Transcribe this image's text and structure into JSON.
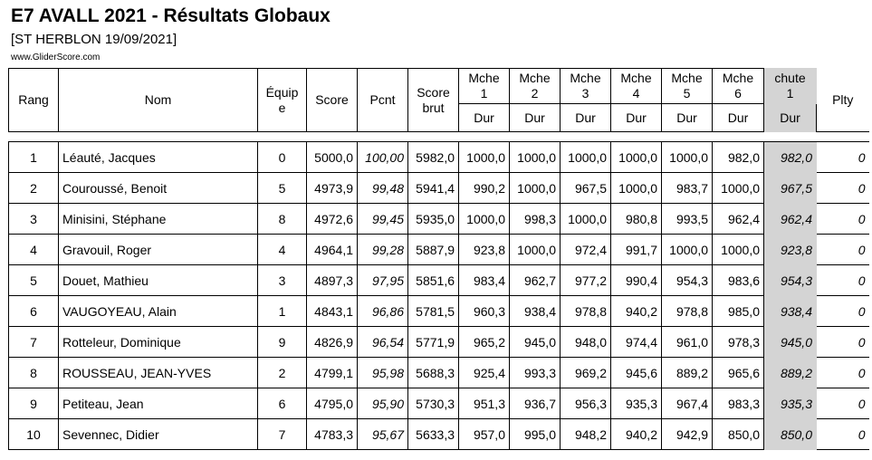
{
  "header": {
    "title": "E7 AVALL 2021 - Résultats Globaux",
    "subtitle": "[ST HERBLON 19/09/2021]",
    "site": "www.GliderScore.com"
  },
  "columns": {
    "rang": "Rang",
    "nom": "Nom",
    "equipe": [
      "Équip",
      "e"
    ],
    "score": "Score",
    "pcnt": "Pcnt",
    "score_brut": [
      "Score",
      "brut"
    ],
    "manches": [
      [
        "Mche",
        "1"
      ],
      [
        "Mche",
        "2"
      ],
      [
        "Mche",
        "3"
      ],
      [
        "Mche",
        "4"
      ],
      [
        "Mche",
        "5"
      ],
      [
        "Mche",
        "6"
      ]
    ],
    "chute": [
      "chute",
      "1"
    ],
    "plty": "Plty",
    "dur": "Dur"
  },
  "rows": [
    {
      "rang": "1",
      "nom": "Léauté, Jacques",
      "equipe": "0",
      "score": "5000,0",
      "pcnt": "100,00",
      "brut": "5982,0",
      "m": [
        "1000,0",
        "1000,0",
        "1000,0",
        "1000,0",
        "1000,0",
        "982,0"
      ],
      "chute": "982,0",
      "plty": "0"
    },
    {
      "rang": "2",
      "nom": "Couroussé, Benoit",
      "equipe": "5",
      "score": "4973,9",
      "pcnt": "99,48",
      "brut": "5941,4",
      "m": [
        "990,2",
        "1000,0",
        "967,5",
        "1000,0",
        "983,7",
        "1000,0"
      ],
      "chute": "967,5",
      "plty": "0"
    },
    {
      "rang": "3",
      "nom": "Minisini, Stéphane",
      "equipe": "8",
      "score": "4972,6",
      "pcnt": "99,45",
      "brut": "5935,0",
      "m": [
        "1000,0",
        "998,3",
        "1000,0",
        "980,8",
        "993,5",
        "962,4"
      ],
      "chute": "962,4",
      "plty": "0"
    },
    {
      "rang": "4",
      "nom": "Gravouil, Roger",
      "equipe": "4",
      "score": "4964,1",
      "pcnt": "99,28",
      "brut": "5887,9",
      "m": [
        "923,8",
        "1000,0",
        "972,4",
        "991,7",
        "1000,0",
        "1000,0"
      ],
      "chute": "923,8",
      "plty": "0"
    },
    {
      "rang": "5",
      "nom": "Douet, Mathieu",
      "equipe": "3",
      "score": "4897,3",
      "pcnt": "97,95",
      "brut": "5851,6",
      "m": [
        "983,4",
        "962,7",
        "977,2",
        "990,4",
        "954,3",
        "983,6"
      ],
      "chute": "954,3",
      "plty": "0"
    },
    {
      "rang": "6",
      "nom": "VAUGOYEAU, Alain",
      "equipe": "1",
      "score": "4843,1",
      "pcnt": "96,86",
      "brut": "5781,5",
      "m": [
        "960,3",
        "938,4",
        "978,8",
        "940,2",
        "978,8",
        "985,0"
      ],
      "chute": "938,4",
      "plty": "0"
    },
    {
      "rang": "7",
      "nom": "Rotteleur, Dominique",
      "equipe": "9",
      "score": "4826,9",
      "pcnt": "96,54",
      "brut": "5771,9",
      "m": [
        "965,2",
        "945,0",
        "948,0",
        "974,4",
        "961,0",
        "978,3"
      ],
      "chute": "945,0",
      "plty": "0"
    },
    {
      "rang": "8",
      "nom": "ROUSSEAU, JEAN-YVES",
      "equipe": "2",
      "score": "4799,1",
      "pcnt": "95,98",
      "brut": "5688,3",
      "m": [
        "925,4",
        "993,3",
        "969,2",
        "945,6",
        "889,2",
        "965,6"
      ],
      "chute": "889,2",
      "plty": "0"
    },
    {
      "rang": "9",
      "nom": "Petiteau, Jean",
      "equipe": "6",
      "score": "4795,0",
      "pcnt": "95,90",
      "brut": "5730,3",
      "m": [
        "951,3",
        "936,7",
        "956,3",
        "935,3",
        "967,4",
        "983,3"
      ],
      "chute": "935,3",
      "plty": "0"
    },
    {
      "rang": "10",
      "nom": "Sevennec, Didier",
      "equipe": "7",
      "score": "4783,3",
      "pcnt": "95,67",
      "brut": "5633,3",
      "m": [
        "957,0",
        "995,0",
        "948,2",
        "940,2",
        "942,9",
        "850,0"
      ],
      "chute": "850,0",
      "plty": "0"
    }
  ]
}
